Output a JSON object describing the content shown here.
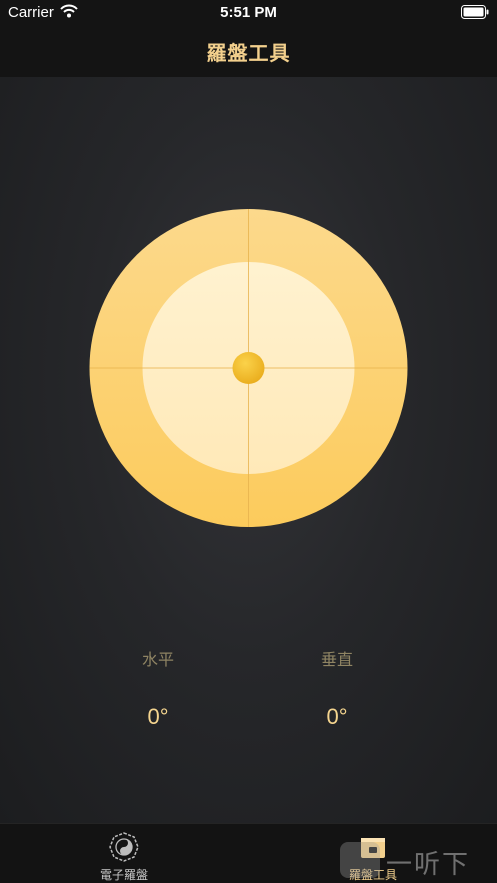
{
  "status_bar": {
    "carrier": "Carrier",
    "time": "5:51 PM",
    "wifi_icon": "wifi-icon",
    "battery_icon": "battery-icon"
  },
  "nav": {
    "title": "羅盤工具"
  },
  "level": {
    "horizontal_label": "水平",
    "vertical_label": "垂直",
    "horizontal_value": "0°",
    "vertical_value": "0°"
  },
  "tabs": [
    {
      "label": "電子羅盤",
      "icon": "bagua-compass-icon",
      "selected": false
    },
    {
      "label": "羅盤工具",
      "icon": "toolbox-icon",
      "selected": true
    }
  ],
  "watermark": {
    "text": "一听下载"
  },
  "colors": {
    "accent": "#f3d08d",
    "label": "#8f8463",
    "dial_outer": "#fcd57a",
    "dial_inner": "#fff0c9",
    "bubble": "#f2b92a"
  }
}
